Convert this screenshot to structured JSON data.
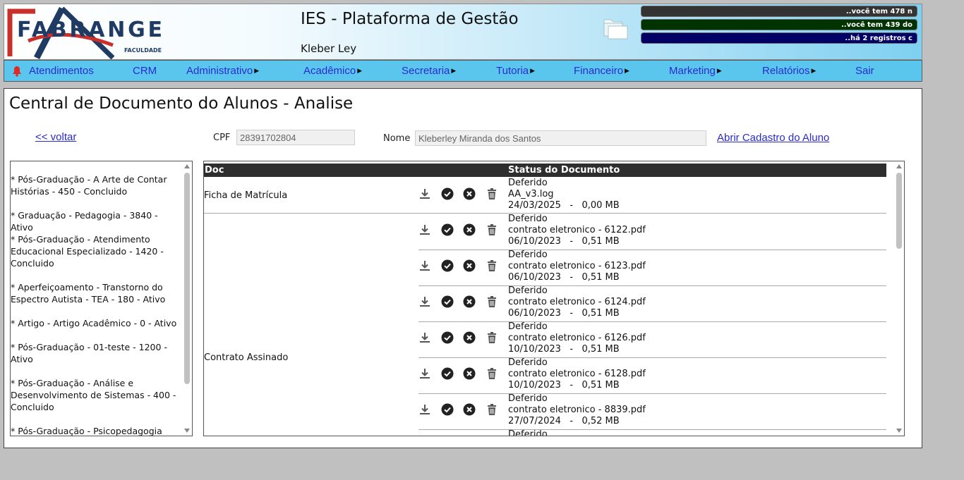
{
  "header": {
    "logo_text": "FABRANGE",
    "logo_sub": "FACULDADE",
    "title": "IES - Plataforma de Gestão",
    "user": "Kleber Ley",
    "notices": [
      "..você tem 478 n",
      "..você tem 439 do",
      "..há 2 registros c"
    ]
  },
  "menu": {
    "items": [
      {
        "label": "Atendimentos",
        "has_sub": false
      },
      {
        "label": "CRM",
        "has_sub": false
      },
      {
        "label": "Administrativo",
        "has_sub": true
      },
      {
        "label": "Acadêmico",
        "has_sub": true
      },
      {
        "label": "Secretaria",
        "has_sub": true
      },
      {
        "label": "Tutoria",
        "has_sub": true
      },
      {
        "label": "Financeiro",
        "has_sub": true
      },
      {
        "label": "Marketing",
        "has_sub": true
      },
      {
        "label": "Relatórios",
        "has_sub": true
      },
      {
        "label": "Sair",
        "has_sub": false
      }
    ],
    "arrow": "▶"
  },
  "page": {
    "title": "Central de Documento do Alunos - Analise",
    "back": "<< voltar",
    "cpf_label": "CPF",
    "cpf_value": "28391702804",
    "nome_label": "Nome",
    "nome_value": "Kleberley Miranda dos Santos",
    "open_link": "Abrir Cadastro do Aluno"
  },
  "courses": [
    "* Pós-Graduação - A Arte de Contar Histórias - 450 - Concluido",
    "* Graduação - Pedagogia - 3840 - Ativo",
    "* Pós-Graduação - Atendimento Educacional Especializado - 1420 - Concluido",
    "* Aperfeiçoamento - Transtorno do Espectro Autista - TEA - 180 - Ativo",
    "* Artigo - Artigo Acadêmico - 0 - Ativo",
    "* Pós-Graduação - 01-teste - 1200 - Ativo",
    "* Pós-Graduação - Análise e Desenvolvimento de Sistemas - 400 - Concluido",
    "* Pós-Graduação - Psicopedagogia"
  ],
  "docs": {
    "col_doc": "Doc",
    "col_status": "Status do Documento",
    "groups": [
      {
        "name": "Ficha de Matrícula"
      },
      {
        "name": "Contrato Assinado"
      }
    ],
    "rows": [
      {
        "status": "Deferido",
        "file": "AA_v3.log",
        "date": "24/03/2025",
        "size": "0,00 MB"
      },
      {
        "status": "Deferido",
        "file": "contrato eletronico - 6122.pdf",
        "date": "06/10/2023",
        "size": "0,51 MB"
      },
      {
        "status": "Deferido",
        "file": "contrato eletronico - 6123.pdf",
        "date": "06/10/2023",
        "size": "0,51 MB"
      },
      {
        "status": "Deferido",
        "file": "contrato eletronico - 6124.pdf",
        "date": "06/10/2023",
        "size": "0,51 MB"
      },
      {
        "status": "Deferido",
        "file": "contrato eletronico - 6126.pdf",
        "date": "10/10/2023",
        "size": "0,51 MB"
      },
      {
        "status": "Deferido",
        "file": "contrato eletronico - 6128.pdf",
        "date": "10/10/2023",
        "size": "0,51 MB"
      },
      {
        "status": "Deferido",
        "file": "contrato eletronico - 8839.pdf",
        "date": "27/07/2024",
        "size": "0,52 MB"
      },
      {
        "status": "Deferido",
        "file": "",
        "date": "",
        "size": ""
      }
    ],
    "separator": "   -   "
  },
  "colors": {
    "menu_bg": "#5bc6ed",
    "link": "#2a2ad0",
    "table_header": "#2e2e2e"
  },
  "icons": [
    "bell-icon",
    "folder-icon",
    "download-icon",
    "approve-icon",
    "reject-icon",
    "trash-icon"
  ]
}
